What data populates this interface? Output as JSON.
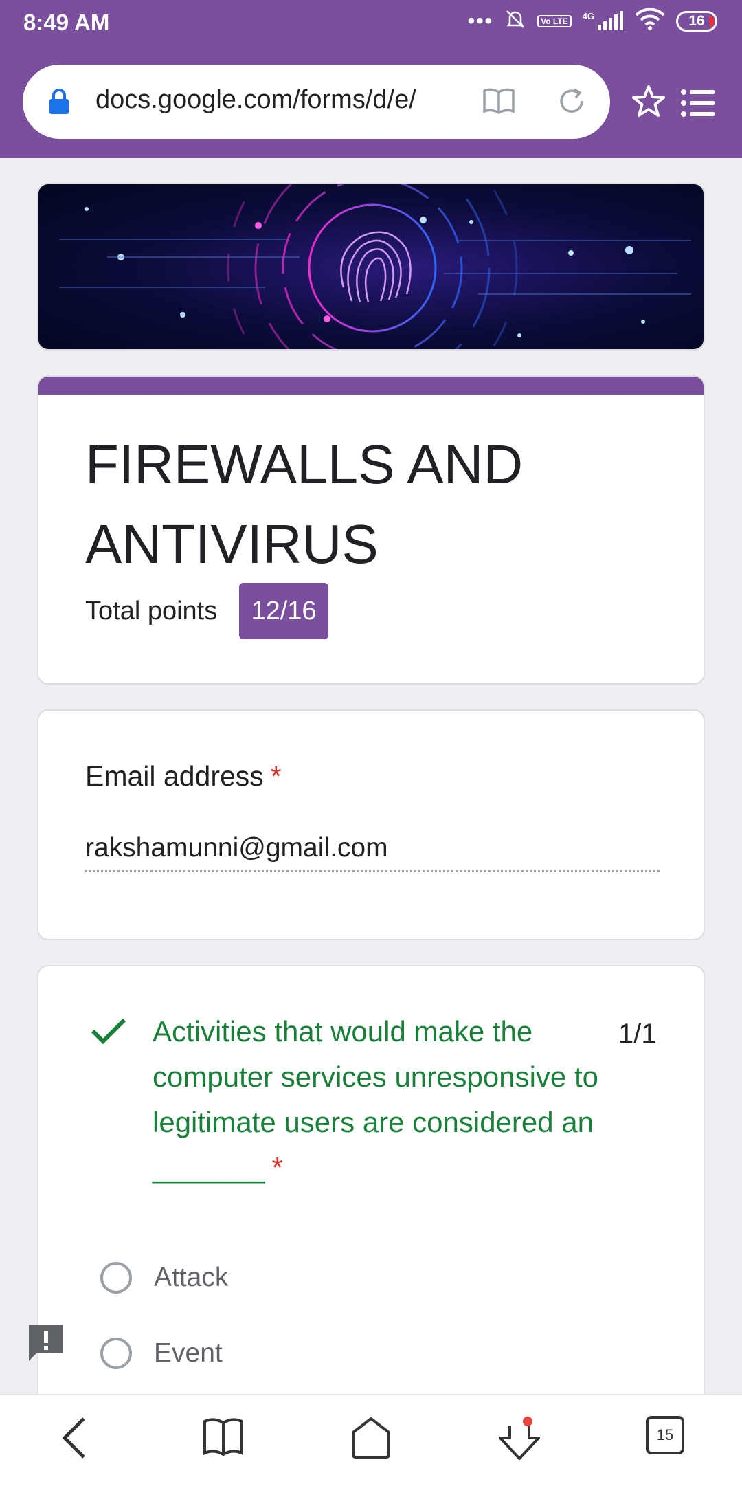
{
  "status_bar": {
    "time": "8:49 AM",
    "volte": "Vo LTE",
    "network": "4G",
    "battery": "16"
  },
  "browser": {
    "url": "docs.google.com/forms/d/e/",
    "tab_count": "15"
  },
  "form": {
    "title": "FIREWALLS AND ANTIVIRUS",
    "total_points_label": "Total points",
    "score_badge": "12/16",
    "accent_color": "#7a4f9d"
  },
  "email_question": {
    "label": "Email address",
    "required_mark": "*",
    "value": "rakshamunni@gmail.com"
  },
  "question1": {
    "text": "Activities that would make the computer services unresponsive to legitimate users are considered an _______",
    "required_mark": "*",
    "score": "1/1",
    "status": "correct",
    "options": [
      "Attack",
      "Event"
    ]
  },
  "icons": {
    "status": [
      "notification-off-icon",
      "signal-icon",
      "wifi-icon",
      "battery-icon"
    ],
    "browser": [
      "lock-icon",
      "reader-mode-icon",
      "reload-icon",
      "star-icon",
      "menu-icon"
    ],
    "bottom": [
      "back-icon",
      "bookmarks-icon",
      "home-icon",
      "download-icon",
      "tabs-icon"
    ]
  }
}
